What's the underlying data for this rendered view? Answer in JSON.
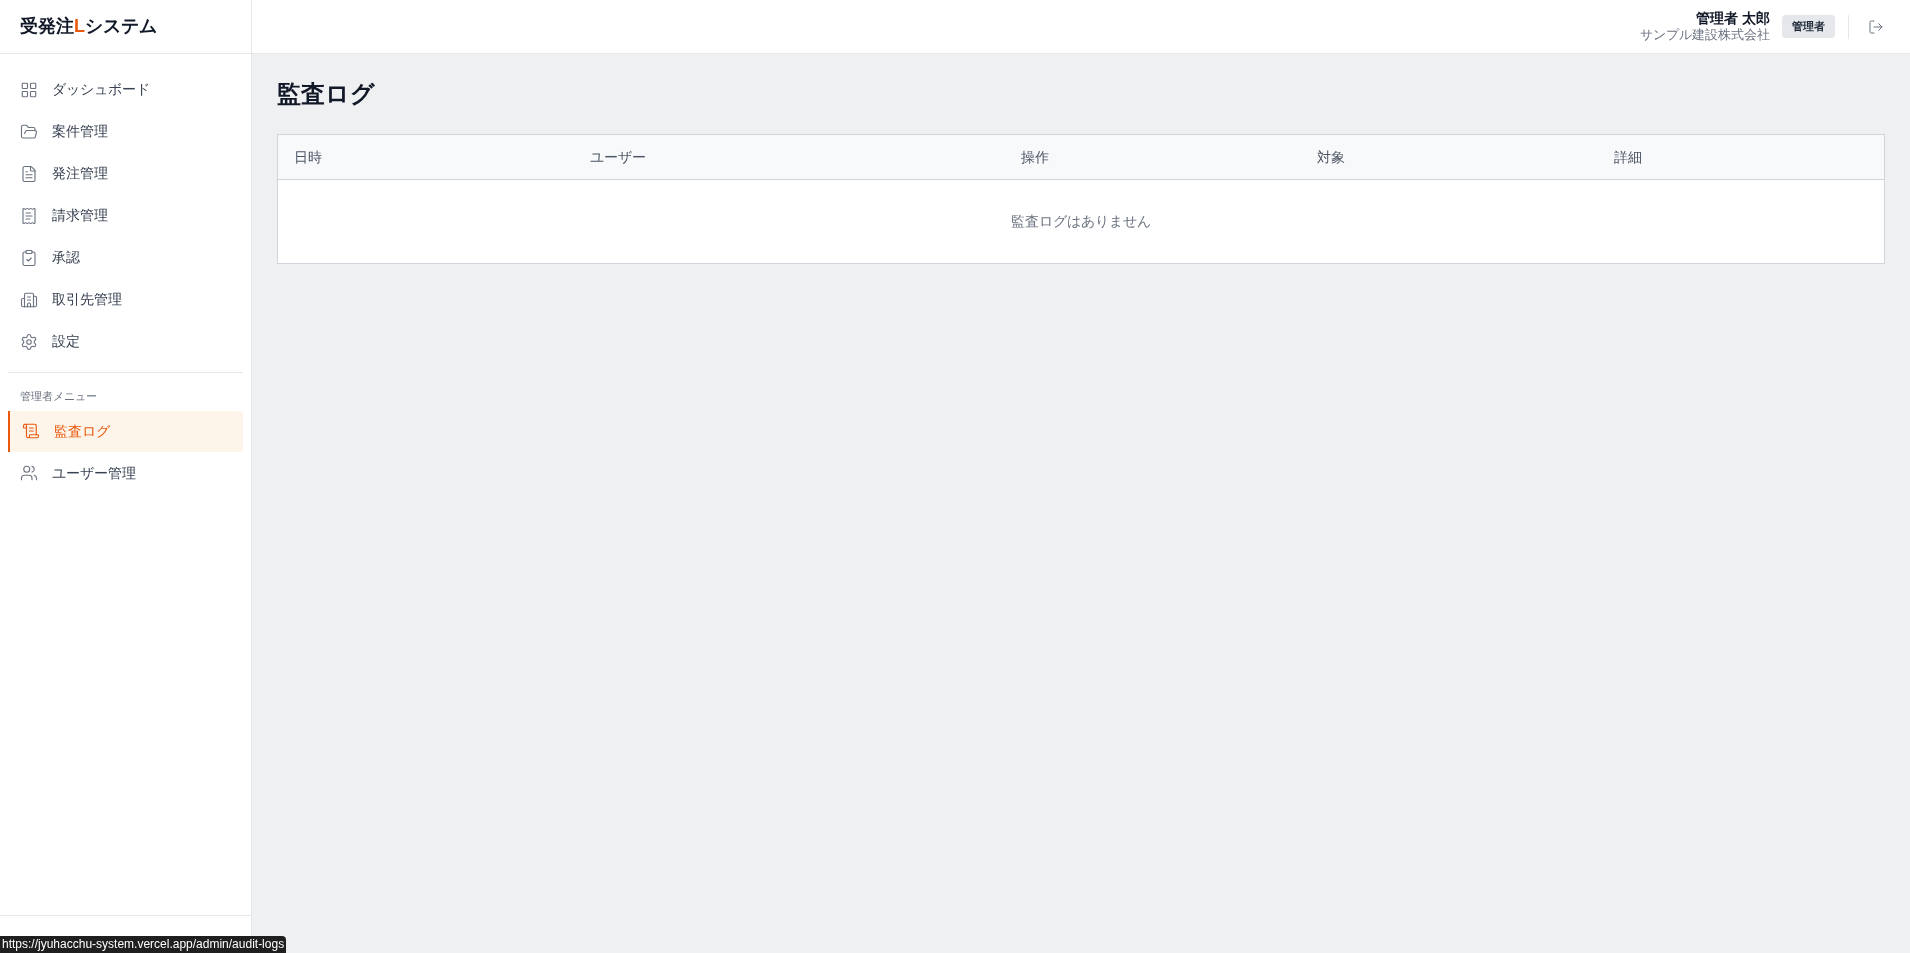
{
  "logo": {
    "parts": [
      "受発注",
      "L",
      "システム"
    ]
  },
  "sidebar": {
    "items": [
      {
        "label": "ダッシュボード",
        "kind": "grid",
        "selected": false
      },
      {
        "label": "案件管理",
        "kind": "folder",
        "selected": false
      },
      {
        "label": "発注管理",
        "kind": "file",
        "selected": false
      },
      {
        "label": "請求管理",
        "kind": "invoice",
        "selected": false
      },
      {
        "label": "承認",
        "kind": "clipboard",
        "selected": false
      },
      {
        "label": "取引先管理",
        "kind": "building",
        "selected": false
      },
      {
        "label": "設定",
        "kind": "gear",
        "selected": false
      }
    ],
    "admin_section": {
      "label": "管理者メニュー",
      "items": [
        {
          "label": "監査ログ",
          "kind": "scroll",
          "selected": true
        },
        {
          "label": "ユーザー管理",
          "kind": "users",
          "selected": false
        }
      ]
    }
  },
  "header": {
    "user_name": "管理者 太郎",
    "company": "サンプル建設株式会社",
    "role_badge": "管理者"
  },
  "page": {
    "title": "監査ログ"
  },
  "table": {
    "columns": [
      "日時",
      "ユーザー",
      "操作",
      "対象",
      "詳細"
    ],
    "empty_message": "監査ログはありません"
  },
  "status_url": "https://jyuhacchu-system.vercel.app/admin/audit-logs"
}
